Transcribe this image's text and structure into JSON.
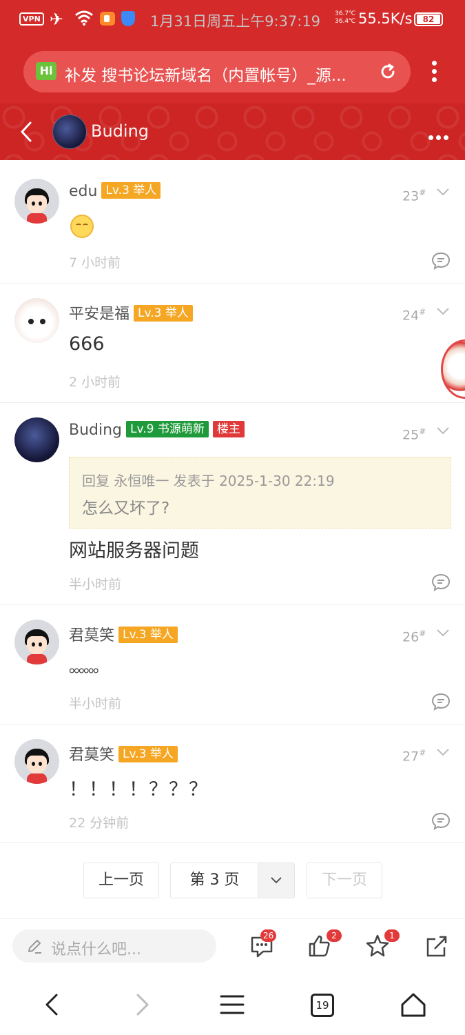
{
  "status_bar": {
    "vpn": "VPN",
    "datetime": "1月31日周五上午9:37:19",
    "temp1": "36.7℃",
    "temp2": "36.4℃",
    "speed": "55.5K/s",
    "battery": "82"
  },
  "address_bar": {
    "badge": "Hi",
    "title": "补发 搜书论坛新域名（内置帐号）_源..."
  },
  "header": {
    "author": "Buding"
  },
  "posts": [
    {
      "user": "edu",
      "level": "Lv.3 举人",
      "floor": "23",
      "floor_mark": "#",
      "content": "",
      "emoji": "smiling-face",
      "time": "7 小时前"
    },
    {
      "user": "平安是福",
      "level": "Lv.3 举人",
      "floor": "24",
      "floor_mark": "#",
      "content": "666",
      "time": "2 小时前"
    },
    {
      "user": "Buding",
      "level": "Lv.9 书源萌新",
      "host_badge": "楼主",
      "floor": "25",
      "floor_mark": "#",
      "quote": {
        "header": "回复 永恒唯一 发表于 2025-1-30 22:19",
        "text": "怎么又坏了?"
      },
      "content": "网站服务器问题",
      "time": "半小时前"
    },
    {
      "user": "君莫笑",
      "level": "Lv.3 举人",
      "floor": "26",
      "floor_mark": "#",
      "content": "。。。。。。",
      "time": "半小时前"
    },
    {
      "user": "君莫笑",
      "level": "Lv.3 举人",
      "floor": "27",
      "floor_mark": "#",
      "content": "！！！！？？？",
      "time": "22 分钟前"
    }
  ],
  "pager": {
    "prev": "上一页",
    "current": "第 3 页",
    "next": "下一页"
  },
  "toolbar": {
    "placeholder": "说点什么吧...",
    "comments_count": "26",
    "likes_count": "2",
    "favorites_count": "1"
  },
  "navbar": {
    "tabs_count": "19"
  },
  "colors": {
    "brand_red": "#d42a29",
    "level_gold": "#f5a623",
    "level_green": "#1f9a3a",
    "host_red": "#e0393a"
  }
}
